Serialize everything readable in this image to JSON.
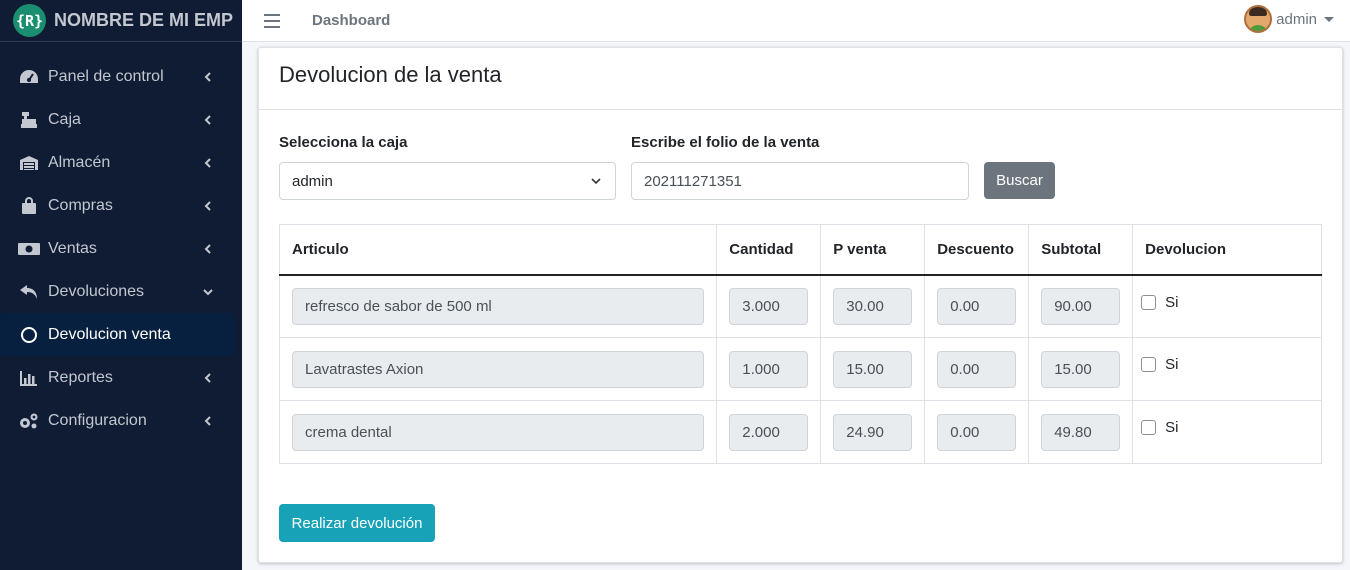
{
  "brand": {
    "logo_text": "{R}",
    "name": "NOMBRE DE MI EMP"
  },
  "sidebar": {
    "items": [
      {
        "label": "Panel de control",
        "icon": "tachometer-icon",
        "arrow": "chevron-left"
      },
      {
        "label": "Caja",
        "icon": "cash-register-icon",
        "arrow": "chevron-left"
      },
      {
        "label": "Almacén",
        "icon": "warehouse-icon",
        "arrow": "chevron-left"
      },
      {
        "label": "Compras",
        "icon": "shopping-bag-icon",
        "arrow": "chevron-left"
      },
      {
        "label": "Ventas",
        "icon": "money-bill-icon",
        "arrow": "chevron-left"
      },
      {
        "label": "Devoluciones",
        "icon": "undo-icon",
        "arrow": "chevron-down"
      },
      {
        "label": "Devolucion venta",
        "icon": "circle-icon",
        "active": true
      },
      {
        "label": "Reportes",
        "icon": "chart-bar-icon",
        "arrow": "chevron-left"
      },
      {
        "label": "Configuracion",
        "icon": "cogs-icon",
        "arrow": "chevron-left"
      }
    ]
  },
  "topbar": {
    "menu_icon": "bars-icon",
    "link": "Dashboard",
    "user": "admin"
  },
  "card": {
    "title": "Devolucion de la venta"
  },
  "form": {
    "caja_label": "Selecciona la caja",
    "caja_value": "admin",
    "folio_label": "Escribe el folio de la venta",
    "folio_value": "202111271351",
    "search_button": "Buscar"
  },
  "table": {
    "headers": [
      "Articulo",
      "Cantidad",
      "P venta",
      "Descuento",
      "Subtotal",
      "Devolucion"
    ],
    "rows": [
      {
        "articulo": "refresco de sabor de 500 ml",
        "cantidad": "3.000",
        "precio": "30.00",
        "descuento": "0.00",
        "subtotal": "90.00",
        "devolucion": "Si"
      },
      {
        "articulo": "Lavatrastes Axion",
        "cantidad": "1.000",
        "precio": "15.00",
        "descuento": "0.00",
        "subtotal": "15.00",
        "devolucion": "Si"
      },
      {
        "articulo": "crema dental",
        "cantidad": "2.000",
        "precio": "24.90",
        "descuento": "0.00",
        "subtotal": "49.80",
        "devolucion": "Si"
      }
    ]
  },
  "submit_button": "Realizar devolución",
  "colors": {
    "sidebar": "#0f1c33",
    "active_item": "#07203f",
    "primary_button": "#17a2b8",
    "secondary_button": "#6c757d"
  }
}
